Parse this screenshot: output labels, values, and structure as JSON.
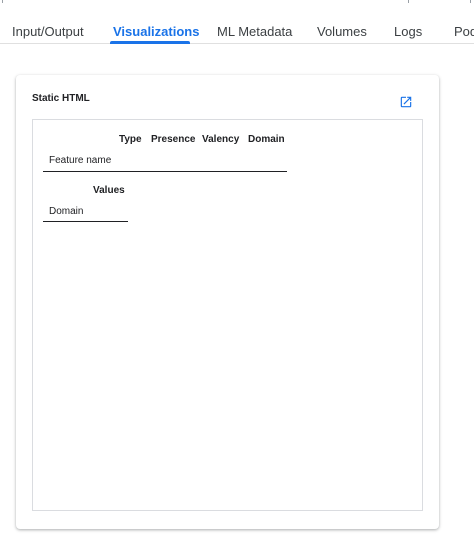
{
  "tabs": [
    {
      "label": "Input/Output"
    },
    {
      "label": "Visualizations"
    },
    {
      "label": "ML Metadata"
    },
    {
      "label": "Volumes"
    },
    {
      "label": "Logs"
    },
    {
      "label": "Pod"
    }
  ],
  "active_tab": "Visualizations",
  "accent_color": "#1a73e8",
  "card": {
    "title": "Static HTML",
    "open_icon": "open-in-new-icon"
  },
  "features_table": {
    "headers": [
      "Type",
      "Presence",
      "Valency",
      "Domain"
    ],
    "row_label": "Feature name"
  },
  "domains_table": {
    "headers": [
      "Values"
    ],
    "row_label": "Domain"
  }
}
